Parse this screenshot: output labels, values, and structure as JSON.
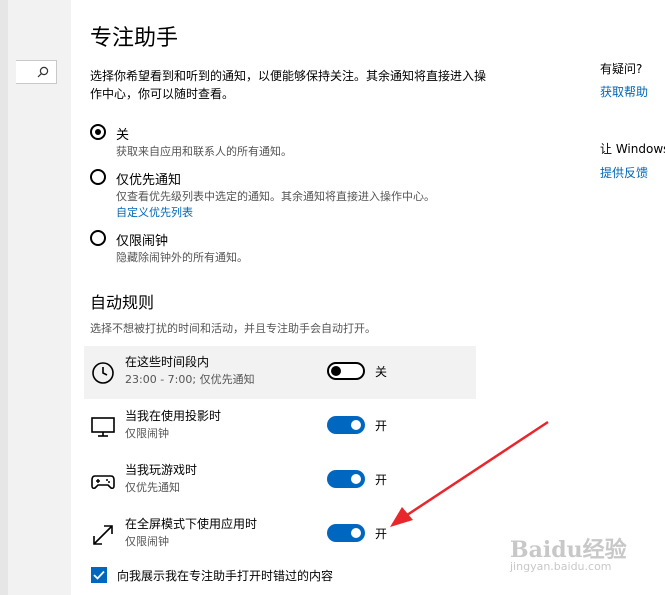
{
  "page": {
    "title": "专注助手",
    "description": "选择你希望看到和听到的通知，以便能够保持关注。其余通知将直接进入操作中心，你可以随时查看。"
  },
  "modes": [
    {
      "label": "关",
      "desc": "获取来自应用和联系人的所有通知。",
      "selected": true
    },
    {
      "label": "仅优先通知",
      "desc": "仅查看优先级列表中选定的通知。其余通知将直接进入操作中心。",
      "link": "自定义优先列表",
      "selected": false
    },
    {
      "label": "仅限闹钟",
      "desc": "隐藏除闹钟外的所有通知。",
      "selected": false
    }
  ],
  "auto_rules": {
    "title": "自动规则",
    "desc": "选择不想被打扰的时间和活动，并且专注助手会自动打开。",
    "rules": [
      {
        "title": "在这些时间段内",
        "sub": "23:00 - 7:00; 仅优先通知",
        "state": "关",
        "on": false,
        "icon": "clock-icon"
      },
      {
        "title": "当我在使用投影时",
        "sub": "仅限闹钟",
        "state": "开",
        "on": true,
        "icon": "monitor-icon"
      },
      {
        "title": "当我玩游戏时",
        "sub": "仅优先通知",
        "state": "开",
        "on": true,
        "icon": "gamepad-icon"
      },
      {
        "title": "在全屏模式下使用应用时",
        "sub": "仅限闹钟",
        "state": "开",
        "on": true,
        "icon": "fullscreen-icon"
      }
    ]
  },
  "checkbox": {
    "label": "向我展示我在专注助手打开时错过的内容",
    "checked": true
  },
  "help": {
    "question": "有疑问?",
    "help_link": "获取帮助",
    "improve": "让 Windows",
    "feedback_link": "提供反馈"
  },
  "watermark": {
    "logo": "Baidu经验",
    "url": "jingyan.baidu.com"
  },
  "colors": {
    "accent": "#0067c0",
    "link": "#0067b8",
    "arrow": "#e8262b"
  }
}
